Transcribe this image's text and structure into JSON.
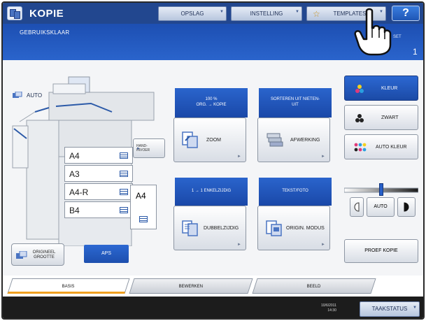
{
  "header": {
    "title": "KOPIE",
    "tabs": [
      {
        "label": "OPSLAG"
      },
      {
        "label": "INSTELLING"
      },
      {
        "label": "TEMPLATES"
      }
    ],
    "help_label": "?"
  },
  "status": {
    "message": "GEBRUIKSKLAAR",
    "set_label": "SET",
    "copy_count": "1"
  },
  "paper": {
    "source_mode": "AUTO",
    "handfinisher_label": "HAND-\nINVOER",
    "trays": [
      {
        "size": "A4"
      },
      {
        "size": "A3"
      },
      {
        "size": "A4-R"
      },
      {
        "size": "B4"
      }
    ],
    "bypass_size": "A4",
    "original_size_label": "ORIGINEEL\nGROOTTE",
    "aps_label": "APS"
  },
  "functions": {
    "zoom": {
      "header": "100 %\nORG.  →  KOPIE",
      "label": "ZOOM"
    },
    "finishing": {
      "header": "SORTEREN UIT NIETEN-\nUIT",
      "label": "AFWERKING"
    },
    "duplex": {
      "header": "1 → 1 ENKELZIJDIG",
      "label": "DUBBELZIJDIG"
    },
    "original_mode": {
      "header": "TEKST/FOTO",
      "label": "ORIGIN. MODUS"
    }
  },
  "color_modes": [
    {
      "label": "KLEUR",
      "active": true
    },
    {
      "label": "ZWART",
      "active": false
    },
    {
      "label": "AUTO KLEUR",
      "active": false
    }
  ],
  "density": {
    "auto_label": "AUTO",
    "level": 0.5
  },
  "proof_copy_label": "PROEF KOPIE",
  "bottom_tabs": [
    {
      "label": "BASIS",
      "active": true
    },
    {
      "label": "BEWERKEN",
      "active": false
    },
    {
      "label": "BEELD",
      "active": false
    }
  ],
  "footer": {
    "date": "10/6/2011",
    "time": "14:30",
    "job_status_label": "TAAKSTATUS"
  },
  "colors": {
    "accent_blue": "#22478f",
    "active_blue": "#2c68d2",
    "tab_underline": "#f0a020"
  }
}
